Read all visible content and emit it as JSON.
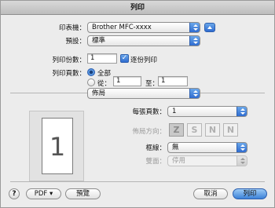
{
  "window": {
    "title": "列印"
  },
  "printer": {
    "label": "印表機：",
    "value": "Brother MFC-xxxx"
  },
  "presets": {
    "label": "預設：",
    "value": "標準"
  },
  "copies": {
    "label": "列印份數：",
    "value": "1",
    "collate_label": "逐份列印",
    "collate_checked": true
  },
  "pages": {
    "label": "列印頁數：",
    "all_label": "全部",
    "from_label": "從：",
    "from_value": "1",
    "to_label": "至：",
    "to_value": "1",
    "selected": "all"
  },
  "panel": {
    "value": "佈局"
  },
  "preview": {
    "page_number": "1"
  },
  "layout": {
    "pages_per_sheet_label": "每張頁數：",
    "pages_per_sheet_value": "1",
    "direction_label": "佈局方向：",
    "direction_icons": [
      "Z",
      "S",
      "N",
      "N"
    ],
    "border_label": "框線：",
    "border_value": "無",
    "two_sided_label": "雙面：",
    "two_sided_value": "停用"
  },
  "footer": {
    "help": "?",
    "pdf_label": "PDF ▾",
    "preview_label": "預覽",
    "cancel_label": "取消",
    "print_label": "列印"
  }
}
